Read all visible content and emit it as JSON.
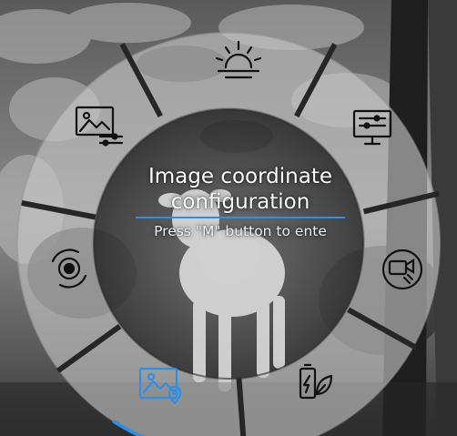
{
  "accent_color": "#2f8fe6",
  "center": {
    "title_line1": "Image coordinate",
    "title_line2": "configuration",
    "hint": "Press \"M\" button to ente"
  },
  "menu_items": [
    {
      "name": "brightness",
      "icon": "sun-rising-icon",
      "selected": false
    },
    {
      "name": "display-settings",
      "icon": "monitor-sliders-icon",
      "selected": false
    },
    {
      "name": "video-settings",
      "icon": "camera-wrench-icon",
      "selected": false
    },
    {
      "name": "power-saving",
      "icon": "battery-leaf-icon",
      "selected": false
    },
    {
      "name": "image-coordinate",
      "icon": "image-location-icon",
      "selected": true
    },
    {
      "name": "calibration",
      "icon": "shutter-icon",
      "selected": false
    },
    {
      "name": "image-adjust",
      "icon": "image-sliders-icon",
      "selected": false
    }
  ]
}
